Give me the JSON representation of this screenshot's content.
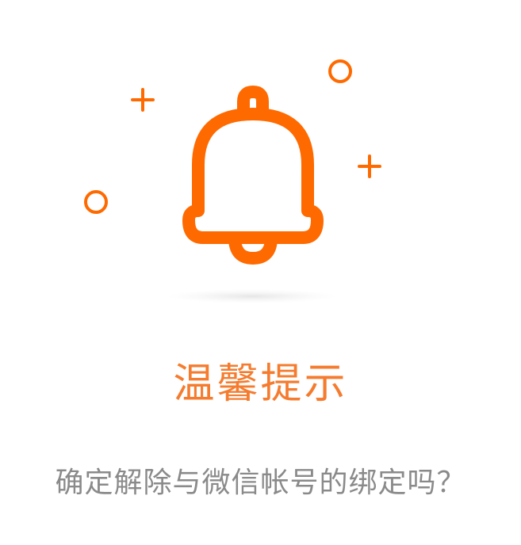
{
  "dialog": {
    "title": "温馨提示",
    "message": "确定解除与微信帐号的绑定吗？"
  },
  "colors": {
    "accent": "#FF6A00",
    "title": "#F57C2F",
    "message": "#8A8A8A",
    "shadow": "#EBEBEB"
  },
  "icons": {
    "main": "bell-icon",
    "decorations": [
      "plus-icon",
      "plus-icon",
      "circle-icon",
      "circle-icon"
    ]
  }
}
